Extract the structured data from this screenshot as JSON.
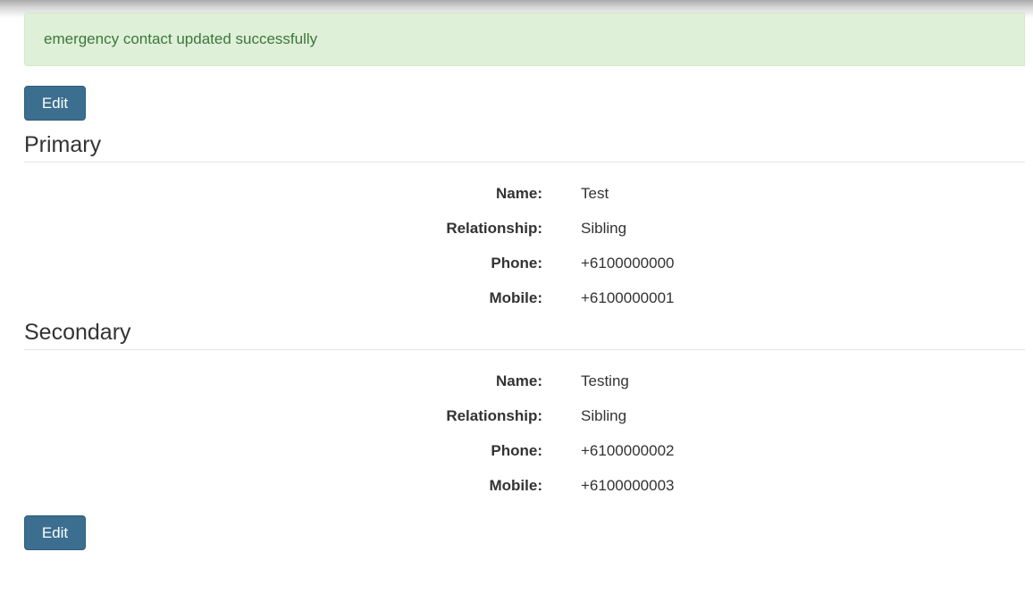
{
  "alert": {
    "message": "emergency contact updated successfully"
  },
  "actions": {
    "edit_label": "Edit"
  },
  "primary": {
    "title": "Primary",
    "fields": [
      {
        "label": "Name:",
        "value": "Test"
      },
      {
        "label": "Relationship:",
        "value": "Sibling"
      },
      {
        "label": "Phone:",
        "value": "+6100000000"
      },
      {
        "label": "Mobile:",
        "value": "+6100000001"
      }
    ]
  },
  "secondary": {
    "title": "Secondary",
    "fields": [
      {
        "label": "Name:",
        "value": "Testing"
      },
      {
        "label": "Relationship:",
        "value": "Sibling"
      },
      {
        "label": "Phone:",
        "value": "+6100000002"
      },
      {
        "label": "Mobile:",
        "value": "+6100000003"
      }
    ]
  },
  "colors": {
    "alert_background": "#dff0d8",
    "alert_text": "#3c763d",
    "button_background": "#3b6e8f"
  }
}
